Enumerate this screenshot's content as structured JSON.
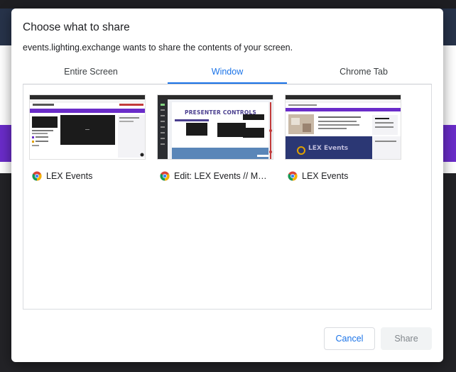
{
  "dialog": {
    "title": "Choose what to share",
    "subtitle": "events.lighting.exchange wants to share the contents of your screen."
  },
  "tabs": [
    {
      "label": "Entire Screen",
      "active": false
    },
    {
      "label": "Window",
      "active": true
    },
    {
      "label": "Chrome Tab",
      "active": false
    }
  ],
  "windows": [
    {
      "label": "LEX Events",
      "icon": "chrome-icon"
    },
    {
      "label": "Edit: LEX Events // Ma...",
      "icon": "chrome-icon",
      "thumb_heading": "PRESENTER CONTROLS"
    },
    {
      "label": "LEX Events",
      "icon": "chrome-icon",
      "thumb_brand": "LEX Events"
    }
  ],
  "buttons": {
    "cancel": "Cancel",
    "share": "Share"
  },
  "colors": {
    "accent": "#1a73e8",
    "brand_purple": "#6a2cc9"
  }
}
